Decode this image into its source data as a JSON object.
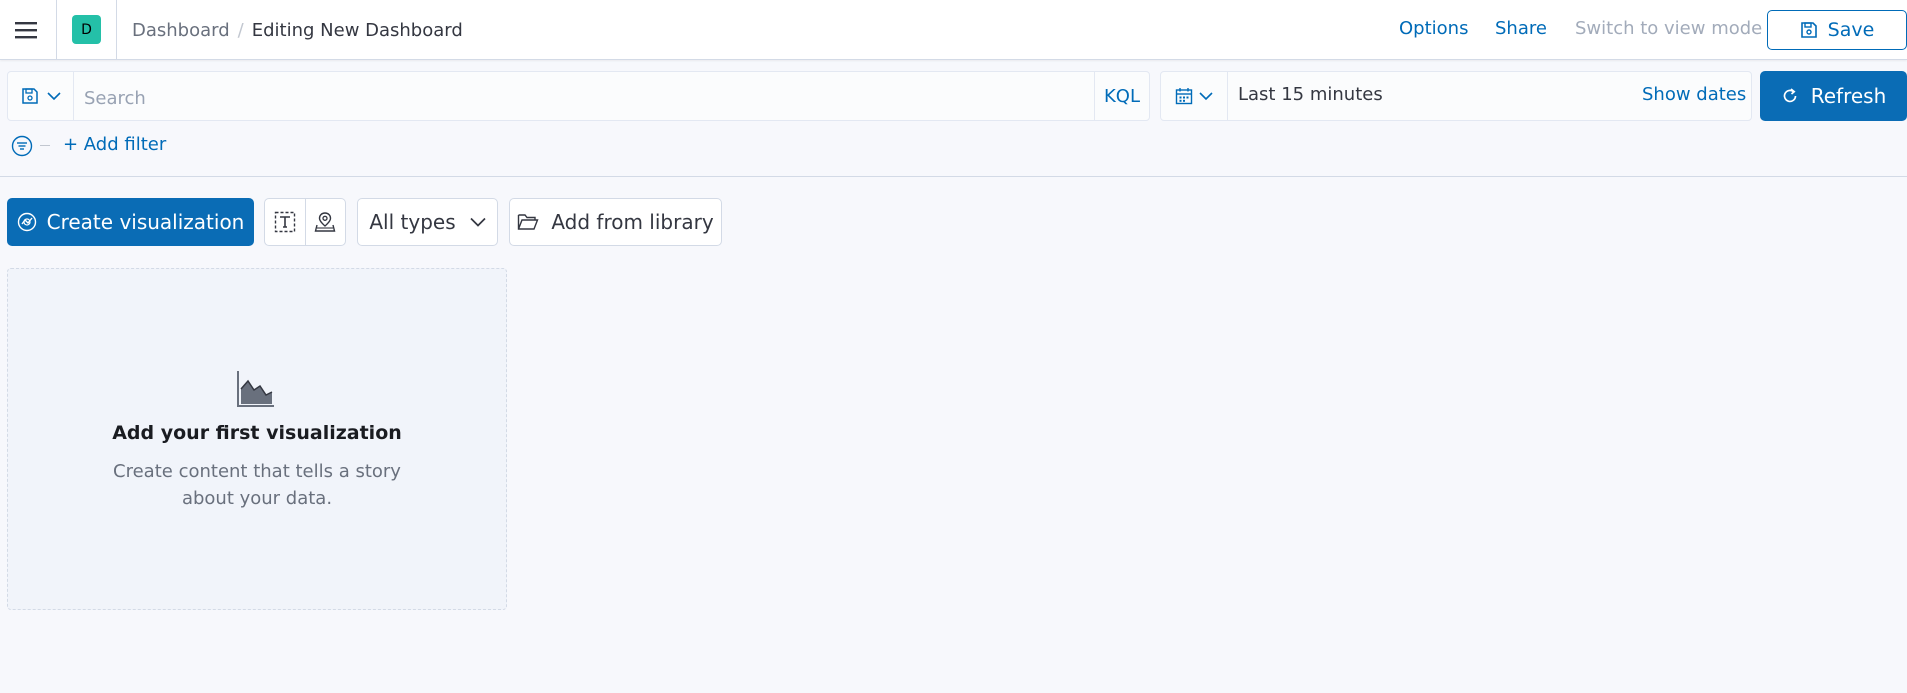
{
  "header": {
    "menu_icon": "hamburger-icon",
    "space_initial": "D",
    "space_color": "#24c0a8",
    "breadcrumbs": [
      {
        "label": "Dashboard",
        "link": true
      },
      {
        "label": "Editing New Dashboard",
        "link": false
      }
    ],
    "breadcrumb_separator": "/",
    "options_label": "Options",
    "share_label": "Share",
    "switch_mode_label": "Switch to view mode",
    "save_label": "Save",
    "save_icon": "save-icon"
  },
  "query_bar": {
    "saved_query_icon": "saved-query-icon",
    "search_placeholder": "Search",
    "search_value": "",
    "language_label": "KQL",
    "date_quick_icon": "calendar-icon",
    "date_range_text": "Last 15 minutes",
    "show_dates_label": "Show dates",
    "refresh_label": "Refresh",
    "refresh_icon": "refresh-icon"
  },
  "filters": {
    "filter_icon": "filter-icon",
    "add_filter_label": "+ Add filter"
  },
  "toolbar": {
    "create_label": "Create visualization",
    "create_icon": "visualize-app-icon",
    "text_icon": "text-panel-icon",
    "maps_icon": "maps-icon",
    "all_types_label": "All types",
    "add_library_label": "Add from library",
    "library_icon": "folder-open-icon"
  },
  "empty_state": {
    "icon": "area-chart-icon",
    "title": "Add your first visualization",
    "description": "Create content that tells a story about your data."
  },
  "colors": {
    "primary": "#0a6cb5",
    "link": "#006bb8",
    "disabled_text": "#a2abba",
    "page_bg": "#f7f8fc"
  }
}
